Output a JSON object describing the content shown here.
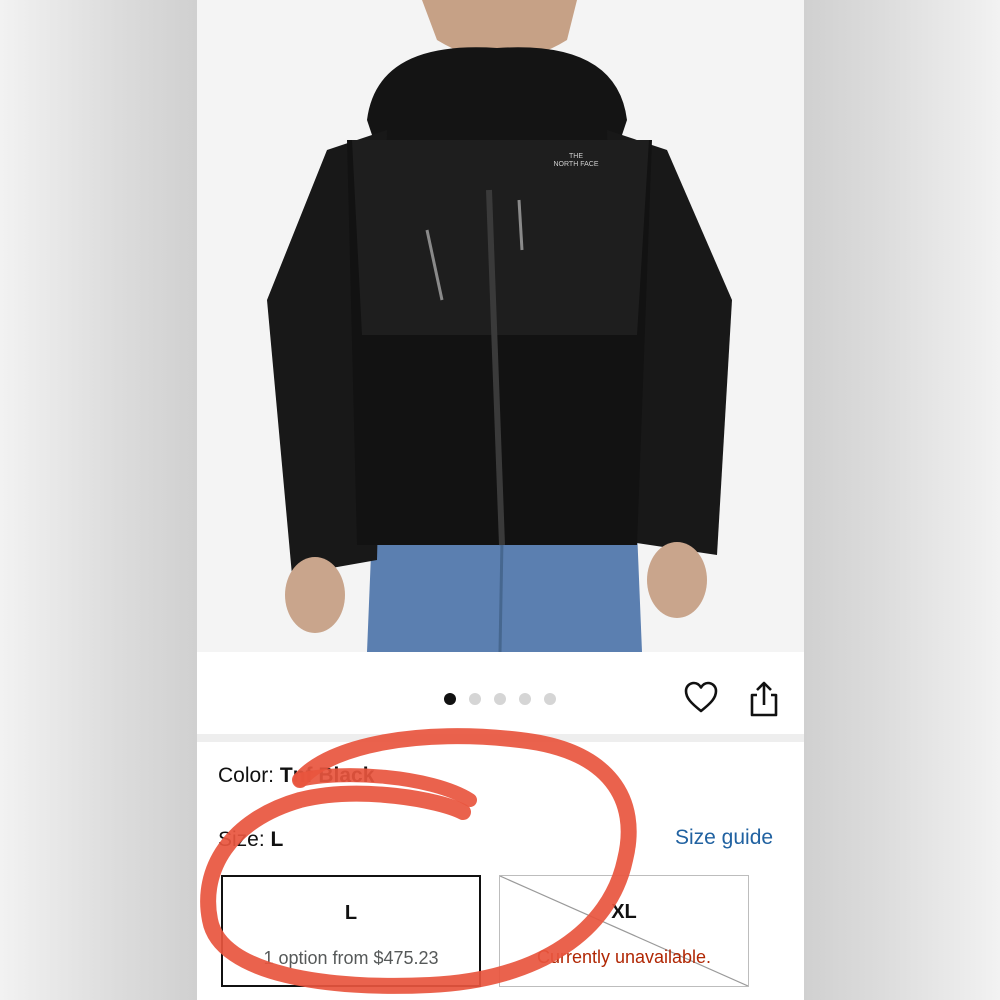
{
  "carousel": {
    "image_count": 5,
    "active_index": 0
  },
  "product": {
    "color_label": "Color:",
    "color_value": "Tnf Black",
    "size_label": "Size:",
    "size_value": "L",
    "size_guide": "Size guide"
  },
  "sizes": [
    {
      "name": "L",
      "detail": "1 option from $475.23",
      "state": "selected"
    },
    {
      "name": "XL",
      "detail": "Currently unavailable.",
      "state": "unavailable"
    }
  ],
  "colors": {
    "link": "#2162a1",
    "unavailable_text": "#b12704",
    "annotation": "#e8553e"
  },
  "icons": [
    "heart-icon",
    "share-icon"
  ]
}
